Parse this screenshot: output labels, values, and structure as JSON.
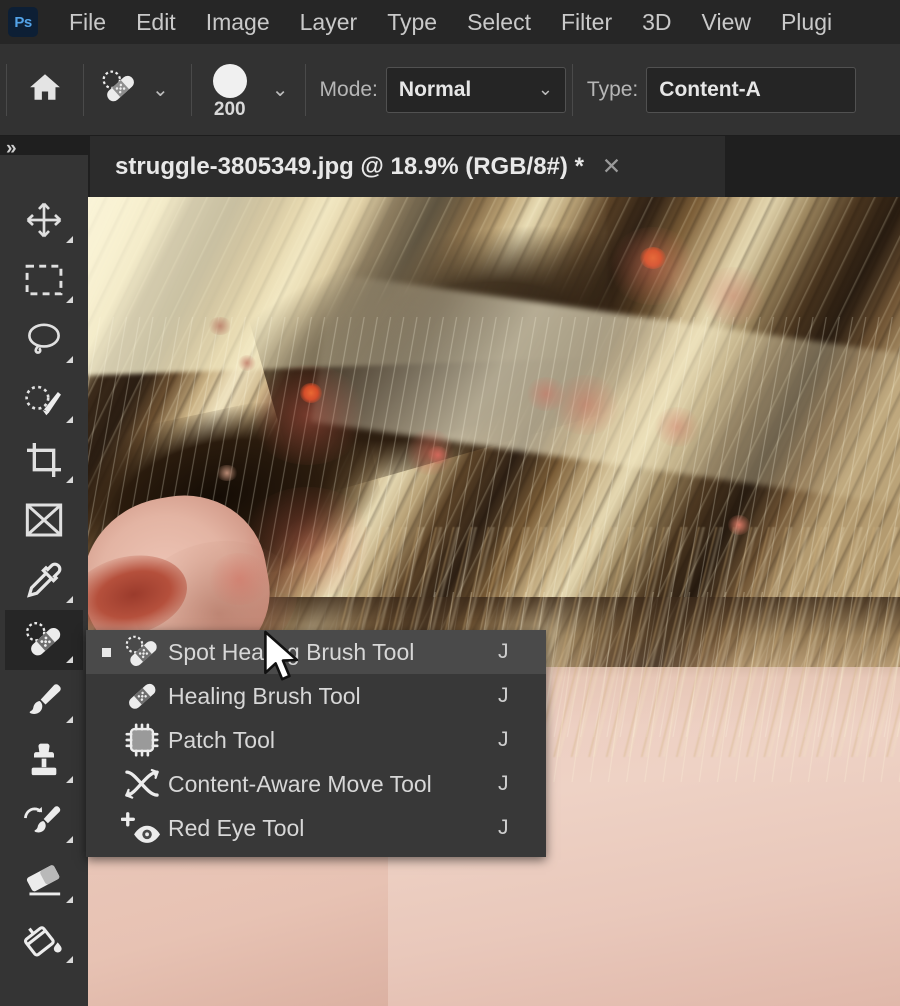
{
  "app": {
    "name": "Adobe Photoshop",
    "logo_text": "Ps",
    "theme_colors": {
      "menubar_bg": "#262626",
      "optionsbar_bg": "#323232",
      "toolbar_bg": "#343434",
      "flyout_bg": "#383838",
      "flyout_active": "#4a4a4a",
      "accent": "#53a3e8",
      "text": "#d4d4d4"
    }
  },
  "menubar": {
    "items": [
      {
        "label": "File"
      },
      {
        "label": "Edit"
      },
      {
        "label": "Image"
      },
      {
        "label": "Layer"
      },
      {
        "label": "Type"
      },
      {
        "label": "Select"
      },
      {
        "label": "Filter"
      },
      {
        "label": "3D"
      },
      {
        "label": "View"
      },
      {
        "label": "Plugi"
      }
    ]
  },
  "options_bar": {
    "home_icon": "home-icon",
    "tool_icon": "spot-healing-brush-icon",
    "tool_preset_chevron": "chevron-down-icon",
    "brush_size": "200",
    "brush_chevron": "chevron-down-icon",
    "mode_label": "Mode:",
    "mode_value": "Normal",
    "mode_chevron": "chevron-down-icon",
    "type_label": "Type:",
    "type_value": "Content-A"
  },
  "tabstrip": {
    "collapse_icon": "double-chevron-right-icon",
    "document_tab": {
      "title": "struggle-3805349.jpg @ 18.9% (RGB/8#) *",
      "close_icon": "close-icon",
      "filename": "struggle-3805349.jpg",
      "zoom": "18.9%",
      "color_mode": "RGB/8#",
      "modified": "*"
    }
  },
  "toolbar": {
    "tools": [
      {
        "name": "move-tool",
        "icon": "move-icon",
        "selected": false,
        "has_flyout": true
      },
      {
        "name": "rectangular-marquee-tool",
        "icon": "marquee-icon",
        "selected": false,
        "has_flyout": true
      },
      {
        "name": "lasso-tool",
        "icon": "lasso-icon",
        "selected": false,
        "has_flyout": true
      },
      {
        "name": "object-selection-tool",
        "icon": "object-selection-icon",
        "selected": false,
        "has_flyout": true
      },
      {
        "name": "crop-tool",
        "icon": "crop-icon",
        "selected": false,
        "has_flyout": true
      },
      {
        "name": "frame-tool",
        "icon": "frame-icon",
        "selected": false,
        "has_flyout": false
      },
      {
        "name": "eyedropper-tool",
        "icon": "eyedropper-icon",
        "selected": false,
        "has_flyout": true
      },
      {
        "name": "spot-healing-brush-tool",
        "icon": "spot-healing-brush-icon",
        "selected": true,
        "has_flyout": true
      },
      {
        "name": "brush-tool",
        "icon": "brush-icon",
        "selected": false,
        "has_flyout": true
      },
      {
        "name": "clone-stamp-tool",
        "icon": "clone-stamp-icon",
        "selected": false,
        "has_flyout": true
      },
      {
        "name": "history-brush-tool",
        "icon": "history-brush-icon",
        "selected": false,
        "has_flyout": true
      },
      {
        "name": "eraser-tool",
        "icon": "eraser-icon",
        "selected": false,
        "has_flyout": true
      },
      {
        "name": "gradient-tool",
        "icon": "paint-bucket-icon",
        "selected": false,
        "has_flyout": true
      }
    ]
  },
  "flyout_menu": {
    "items": [
      {
        "label": "Spot Healing Brush Tool",
        "shortcut": "J",
        "icon": "spot-healing-brush-icon",
        "active": true,
        "bullet": true
      },
      {
        "label": "Healing Brush Tool",
        "shortcut": "J",
        "icon": "healing-brush-icon",
        "active": false,
        "bullet": false
      },
      {
        "label": "Patch Tool",
        "shortcut": "J",
        "icon": "patch-icon",
        "active": false,
        "bullet": false
      },
      {
        "label": "Content-Aware Move Tool",
        "shortcut": "J",
        "icon": "content-aware-move-icon",
        "active": false,
        "bullet": false
      },
      {
        "label": "Red Eye Tool",
        "shortcut": "J",
        "icon": "red-eye-icon",
        "active": false,
        "bullet": false
      }
    ]
  },
  "canvas": {
    "description": "Zoomed photo of a person's temple: blonde and brown hair strands across the top-left, an ear at mid-left, and acne-blemished skin filling the lower right",
    "zoom_level": "18.9%"
  }
}
